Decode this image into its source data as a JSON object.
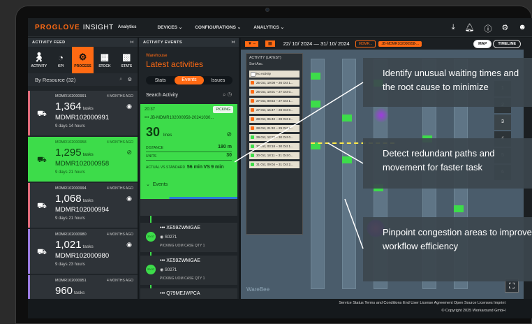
{
  "header": {
    "logo_a": "PROGLOVE",
    "logo_b": "INSIGHT",
    "logo_c": "Analytics",
    "nav": [
      "DEVICES ⌄",
      "CONFIGURATIONS ⌄",
      "ANALYTICS ⌄"
    ]
  },
  "feed": {
    "title": "ACTIVITY FEED",
    "tabs": [
      "ACTIVITY",
      "KPI",
      "PROCESS",
      "STOCK",
      "STATS"
    ],
    "filter": "By Resource (32)",
    "cards": [
      {
        "id": "MDMR102000991",
        "ago": "4 MONTHS AGO",
        "tasks": "1,364",
        "unit": "tasks",
        "name": "MDMR102000991",
        "dur": "9 days 14 hours"
      },
      {
        "id": "MDMR102000958",
        "ago": "4 MONTHS AGO",
        "tasks": "1,295",
        "unit": "tasks",
        "name": "MDMR102000958",
        "dur": "9 days 21 hours"
      },
      {
        "id": "MDMR102000994",
        "ago": "4 MONTHS AGO",
        "tasks": "1,068",
        "unit": "tasks",
        "name": "MDMR102000994",
        "dur": "9 days 21 hours"
      },
      {
        "id": "MDMR102000980",
        "ago": "4 MONTHS AGO",
        "tasks": "1,021",
        "unit": "tasks",
        "name": "MDMR102000980",
        "dur": "9 days 23 hours"
      },
      {
        "id": "MDMR102000951",
        "ago": "4 MONTHS AGO",
        "tasks": "960",
        "unit": "tasks",
        "name": "",
        "dur": ""
      }
    ]
  },
  "events": {
    "title": "ACTIVITY EVENTS",
    "warehouse": "Warehouse",
    "heading": "Latest activities",
    "seg": [
      "Stats",
      "Events",
      "Issues"
    ],
    "search": "Search Activity",
    "card": {
      "time": "20:37",
      "badge": "PICKING",
      "ref": "JB-MDMR102000958-20241030...",
      "lines": "30",
      "lines_unit": "lines",
      "distance_label": "DISTANCE",
      "distance": "180 m",
      "units_label": "UNITS",
      "units": "30",
      "std_label": "ACTUAL VS STANDARD",
      "actual": "56 min",
      "vs": "VS",
      "standard": "9 min",
      "events_label": "Events"
    },
    "timeline": [
      {
        "time": "20:37",
        "sku": "XE59ZWMGAE",
        "loc": "S0271",
        "detail": "PICKING  UOM CASE  QTY 1"
      },
      {
        "time": "20:37",
        "sku": "XE59ZWMGAE",
        "loc": "S0271",
        "detail": "PICKING  UOM CASE  QTY 1"
      },
      {
        "time": "20:37",
        "sku": "Q79MEJWPCA",
        "loc": "",
        "detail": ""
      }
    ]
  },
  "map": {
    "date_range": "22/ 10/ 2024 — 31/ 10/ 2024",
    "pill1": "MDMR...",
    "pill2": "JB-MDMR102000958-...",
    "btn_map": "MAP",
    "btn_timeline": "TIMELINE",
    "list_title": "ACTIVITY (LATEST)",
    "sort": "Sort Asc.",
    "no_activity": "No Activity",
    "items": [
      "25 Oct, 19:08 – 26 Oct 1...",
      "26 Oct, 10:01 – 27 Oct 0...",
      "27 Oct, 00:54 – 27 Oct 1...",
      "27 Oct, 15:47 – 28 Oct 0...",
      "28 Oct, 06:40 – 28 Oct 2...",
      "28 Oct, 21:32 – 29 Oct 1...",
      "29 Oct, 12:25 – 30 Oct 0...",
      "30 Oct, 03:18 – 30 Oct 1...",
      "30 Oct, 18:11 – 31 Oct 0...",
      "31 Oct, 09:04 – 31 Oct 2..."
    ],
    "levels": [
      "1",
      "2",
      "3",
      "4",
      "5",
      "6"
    ],
    "watermark": "WareBee"
  },
  "overlays": [
    "Identify unusual waiting times and the root cause to minimize",
    "Detect redundant paths and movement for faster task",
    "Pinpoint congestion areas to improve workflow efficiency"
  ],
  "footer": {
    "links": "Service Status   Terms and Conditions   End User License Agreement   Open Source Licenses   Imprint",
    "copyright": "© Copyright 2025 Workaround GmbH"
  }
}
